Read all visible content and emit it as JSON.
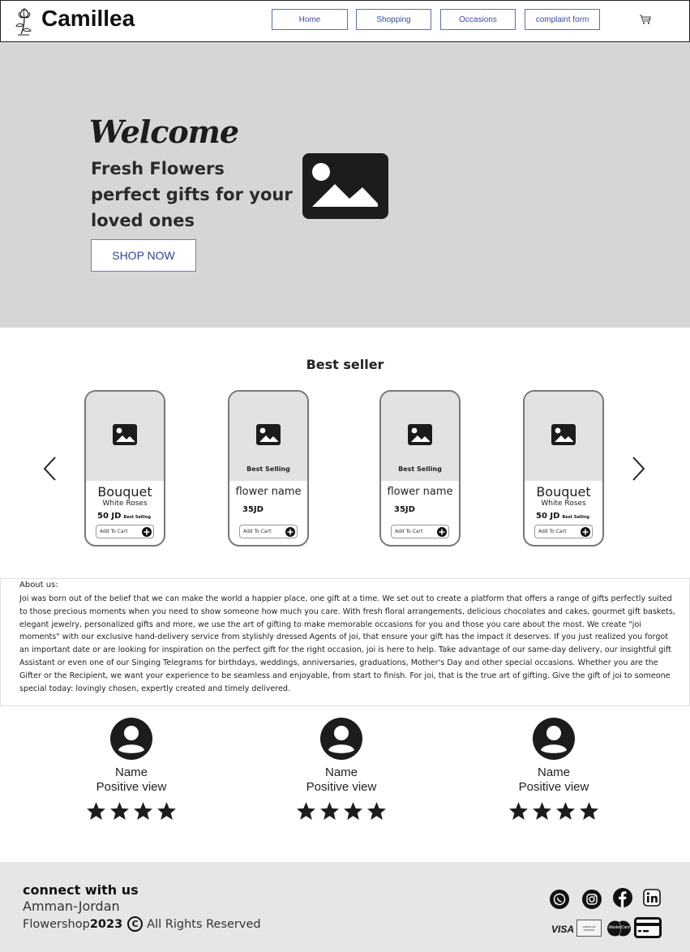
{
  "header": {
    "brand": "Camillea",
    "logo_icon": "flower-icon",
    "nav": [
      {
        "label": "Home"
      },
      {
        "label": "Shopping"
      },
      {
        "label": "Occasions"
      },
      {
        "label": "complaint form"
      }
    ],
    "cart_icon": "cart-icon"
  },
  "hero": {
    "welcome": "Welcome",
    "tagline": "Fresh Flowers perfect gifts for your loved ones",
    "cta": "SHOP NOW",
    "image_icon": "image-placeholder-icon"
  },
  "best_seller": {
    "title": "Best seller",
    "cards": [
      {
        "badge_top": "",
        "title": "Bouquet",
        "subtitle": "White Roses",
        "price": "50 JD",
        "price_badge": "Best Selling",
        "add_to_cart": "Add To Cart"
      },
      {
        "badge_top": "Best Selling",
        "title": "flower name",
        "subtitle": "",
        "price": "35JD",
        "price_badge": "",
        "add_to_cart": "Add To Cart"
      },
      {
        "badge_top": "Best Selling",
        "title": "flower name",
        "subtitle": "",
        "price": "35JD",
        "price_badge": "",
        "add_to_cart": "Add To Cart"
      },
      {
        "badge_top": "",
        "title": "Bouquet",
        "subtitle": "White Roses",
        "price": "50 JD",
        "price_badge": "Best Selling",
        "add_to_cart": "Add To Cart"
      }
    ],
    "prev_icon": "chevron-left-icon",
    "next_icon": "chevron-right-icon"
  },
  "about": {
    "title": "About us:",
    "text": "Joi was born out of the belief that we can make the world a happier place, one gift at a time. We set out to create a platform that offers a range of gifts perfectly suited to those precious moments when you need to show someone how much you care. With fresh floral arrangements, delicious chocolates and cakes, gourmet gift baskets, elegant jewelry, personalized gifts and more, we use the art of gifting to make memorable occasions for you and those you care about the most. We create \"joi moments\" with our exclusive hand-delivery service from stylishly dressed Agents of joi, that ensure your gift has the impact it deserves. If you just realized you forgot an important date or are looking for inspiration on the perfect gift for the right occasion, joi is here to help. Take advantage of our same-day delivery, our insightful gift Assistant or even one of our Singing Telegrams for birthdays, weddings, anniversaries, graduations, Mother's Day and other special occasions. Whether you are the Gifter or the Recipient, we want your experience to be seamless and enjoyable, from start to finish. For joi, that is the true art of gifting. Give the gift of joi to someone special today: lovingly chosen, expertly created and timely delivered."
  },
  "reviews": [
    {
      "name": "Name",
      "text": "Positive view",
      "stars": 4
    },
    {
      "name": "Name",
      "text": "Positive view",
      "stars": 4
    },
    {
      "name": "Name",
      "text": "Positive view",
      "stars": 4
    }
  ],
  "footer": {
    "title": "connect with us",
    "location": "Amman-Jordan",
    "brand_prefix": "Flowershop",
    "year": "2023",
    "copyright_symbol": "C",
    "rights": "All Rights Reserved",
    "social_icons": [
      "whatsapp-icon",
      "instagram-icon",
      "facebook-icon",
      "linkedin-icon"
    ],
    "payment": {
      "visa": "VISA",
      "amex": "AMERICAN EXPRESS",
      "mastercard": "MasterCard"
    }
  }
}
